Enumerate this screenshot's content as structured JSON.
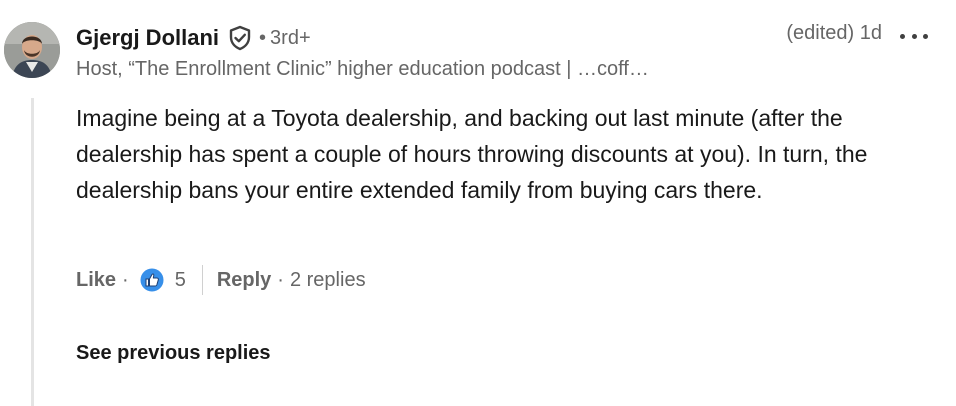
{
  "comment": {
    "author": {
      "name": "Gjergj Dollani",
      "degree_separator": "•",
      "degree": "3rd+",
      "headline": "Host, “The Enrollment Clinic” higher education podcast | …coff…"
    },
    "edited_label": "(edited)",
    "time_ago": "1d",
    "body": "Imagine being at a Toyota dealership, and backing out last minute (after the dealership has spent a couple of hours throwing discounts at you). In turn, the dealership bans your entire extended family from buying cars there.",
    "actions": {
      "like_label": "Like",
      "separator": "·",
      "reaction_count": "5",
      "reply_label": "Reply",
      "replies_label": "2 replies"
    }
  },
  "see_previous_label": "See previous replies",
  "icons": {
    "verified": "verified-shield-icon",
    "like_reaction": "thumbs-up-reaction-icon",
    "more": "more-options-icon"
  },
  "colors": {
    "like_blue": "#378fe9",
    "secondary_text": "#666666",
    "primary_text": "#191919"
  }
}
